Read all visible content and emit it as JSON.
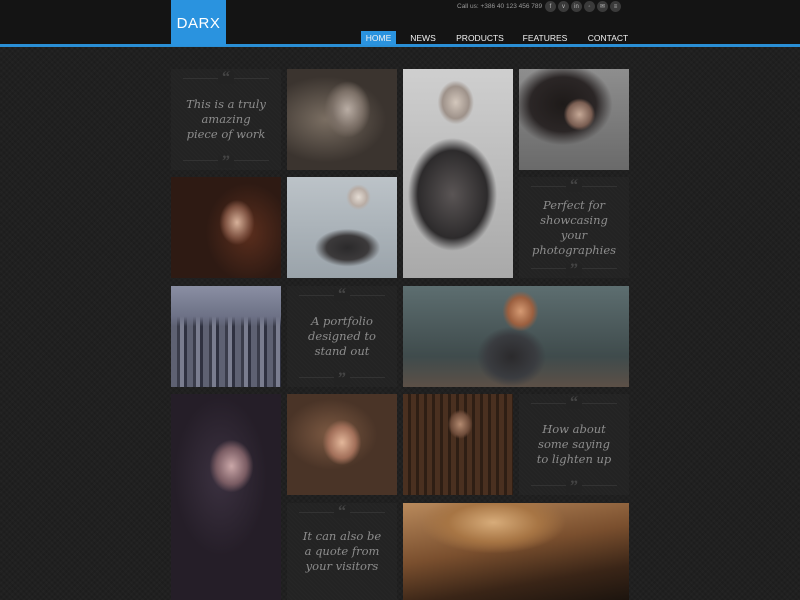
{
  "header": {
    "logo": "DARX",
    "call_text": "Call us: +386 40 123 456 789",
    "social_icons": [
      "facebook-icon",
      "vimeo-icon",
      "linkedin-icon",
      "flickr-icon",
      "email-icon",
      "rss-icon"
    ],
    "social_glyphs": [
      "f",
      "v",
      "in",
      "◦",
      "✉",
      "≡"
    ]
  },
  "nav": {
    "items": [
      "Home",
      "News",
      "Products",
      "Features",
      "Contact"
    ],
    "active": "Home"
  },
  "quotes": {
    "q1": "This is a truly amazing piece of work",
    "q2": "Perfect for showcasing your photographies",
    "q3": "A portfolio designed to stand out",
    "q4": "How about some saying to lighten up",
    "q5": "It can also be a quote from your visitors"
  },
  "colors": {
    "accent": "#2a93df",
    "background": "#1e1e1e",
    "quote_text": "#8d8d8d"
  }
}
